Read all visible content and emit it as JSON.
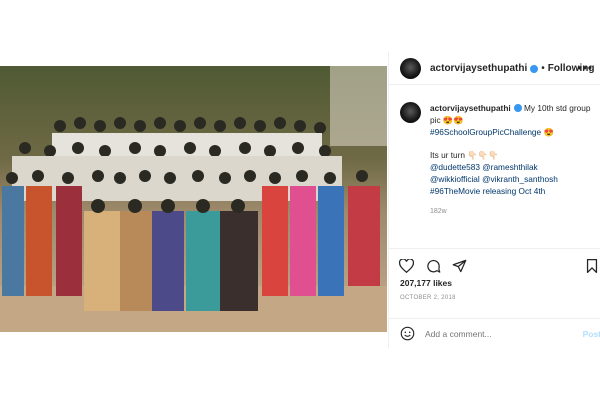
{
  "post": {
    "username": "actorvijaysethupathi",
    "follow_label": "Following",
    "more_icon": "more-horizontal-icon",
    "separator": "•",
    "caption_user": "actorvijaysethupathi",
    "caption_line1": "My 10th std group pic 😍😍",
    "caption_hashtag": "#96SchoolGroupPicChallenge 😍",
    "caption_turn": "Its ur turn 👇🏻👇🏻👇🏻",
    "mentions": [
      "@dudette583 @rameshthilak",
      "@wikkiofficial @vikranth_santhosh"
    ],
    "caption_release": "#96TheMovie releasing Oct 4th",
    "comment_time": "182w",
    "likes": "207,177 likes",
    "date": "OCTOBER 2, 2018",
    "comment_placeholder": "Add a comment...",
    "post_label": "Post"
  },
  "icons": {
    "like": "heart-icon",
    "comment": "comment-icon",
    "share": "send-icon",
    "save": "bookmark-icon",
    "emoji": "smiley-icon"
  },
  "colors": {
    "verified": "#3897f0",
    "link": "#00376b",
    "muted": "#8e8e8e"
  }
}
